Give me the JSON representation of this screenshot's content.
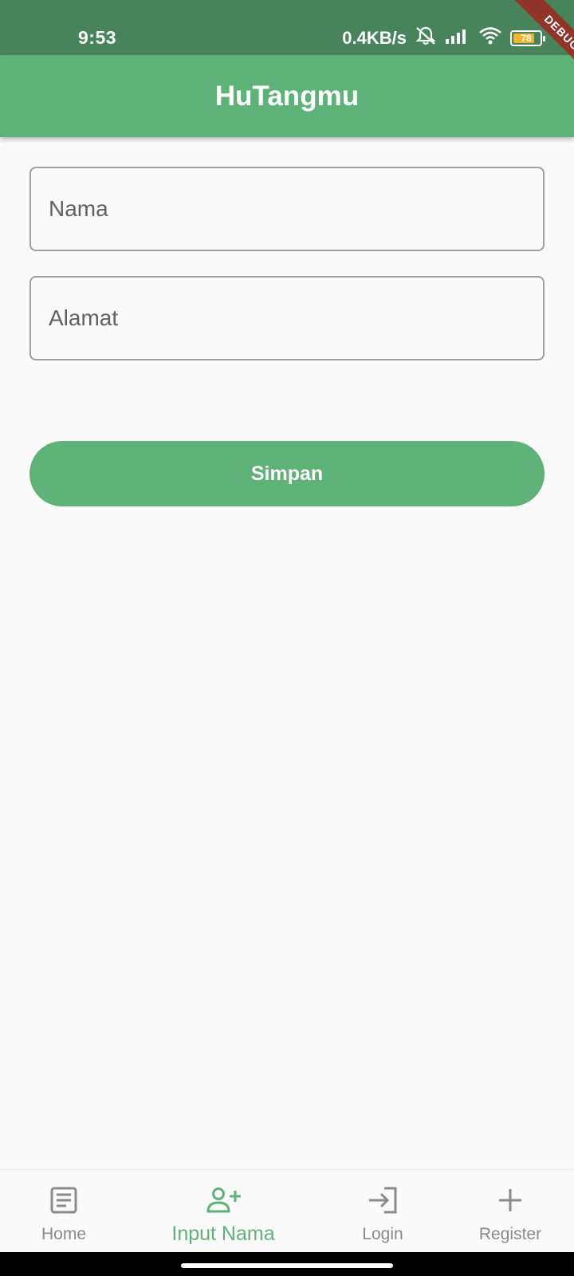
{
  "status_bar": {
    "time": "9:53",
    "net_speed": "0.4KB/s",
    "battery_level": "78",
    "icons": [
      "notifications-off-icon",
      "signal-icon",
      "wifi-icon",
      "battery-icon"
    ]
  },
  "debug_banner": "DEBUG",
  "app_bar": {
    "title": "HuTangmu"
  },
  "form": {
    "name_placeholder": "Nama",
    "address_placeholder": "Alamat",
    "save_label": "Simpan"
  },
  "bottom_nav": {
    "items": [
      {
        "label": "Home",
        "icon": "article-icon",
        "active": false
      },
      {
        "label": "Input Nama",
        "icon": "person-add-icon",
        "active": true
      },
      {
        "label": "Login",
        "icon": "login-icon",
        "active": false
      },
      {
        "label": "Register",
        "icon": "plus-icon",
        "active": false
      }
    ]
  },
  "colors": {
    "primary": "#5fb277",
    "status_bar": "#47845a",
    "inactive": "#8a8a8a",
    "background": "#fafafa"
  }
}
